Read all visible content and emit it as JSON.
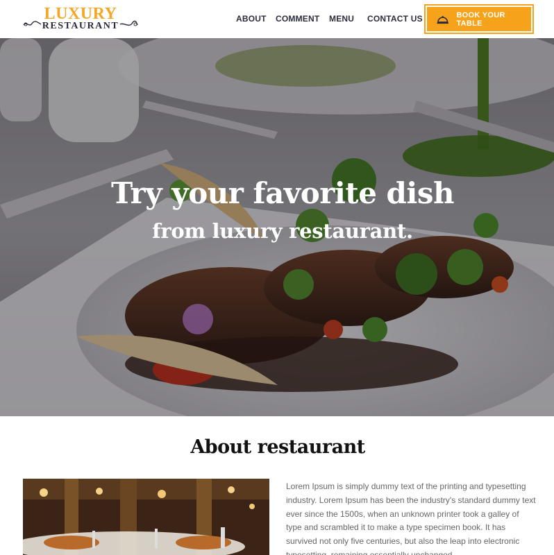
{
  "brand": {
    "logo_top": "LUXURY",
    "logo_bottom": "RESTAURANT",
    "accent_color": "#f7a21b",
    "dark_color": "#2a2a3a"
  },
  "nav": {
    "items": [
      {
        "label": "ABOUT"
      },
      {
        "label": "COMMENT"
      },
      {
        "label": "MENU"
      },
      {
        "label": "CONTACT US"
      }
    ],
    "book_button": {
      "label": "BOOK YOUR TABLE",
      "icon": "cloche-icon"
    }
  },
  "hero": {
    "title": "Try your favorite dish",
    "subtitle": "from luxury restaurant."
  },
  "about": {
    "title": "About restaurant",
    "body": "Lorem Ipsum is simply dummy text of the printing and typesetting industry. Lorem Ipsum has been the industry's standard dummy text ever since the 1500s, when an unknown printer took a galley of type and scrambled it to make a type specimen book. It has survived not only five centuries, but also the leap into electronic typesetting, remaining essentially unchanged."
  }
}
